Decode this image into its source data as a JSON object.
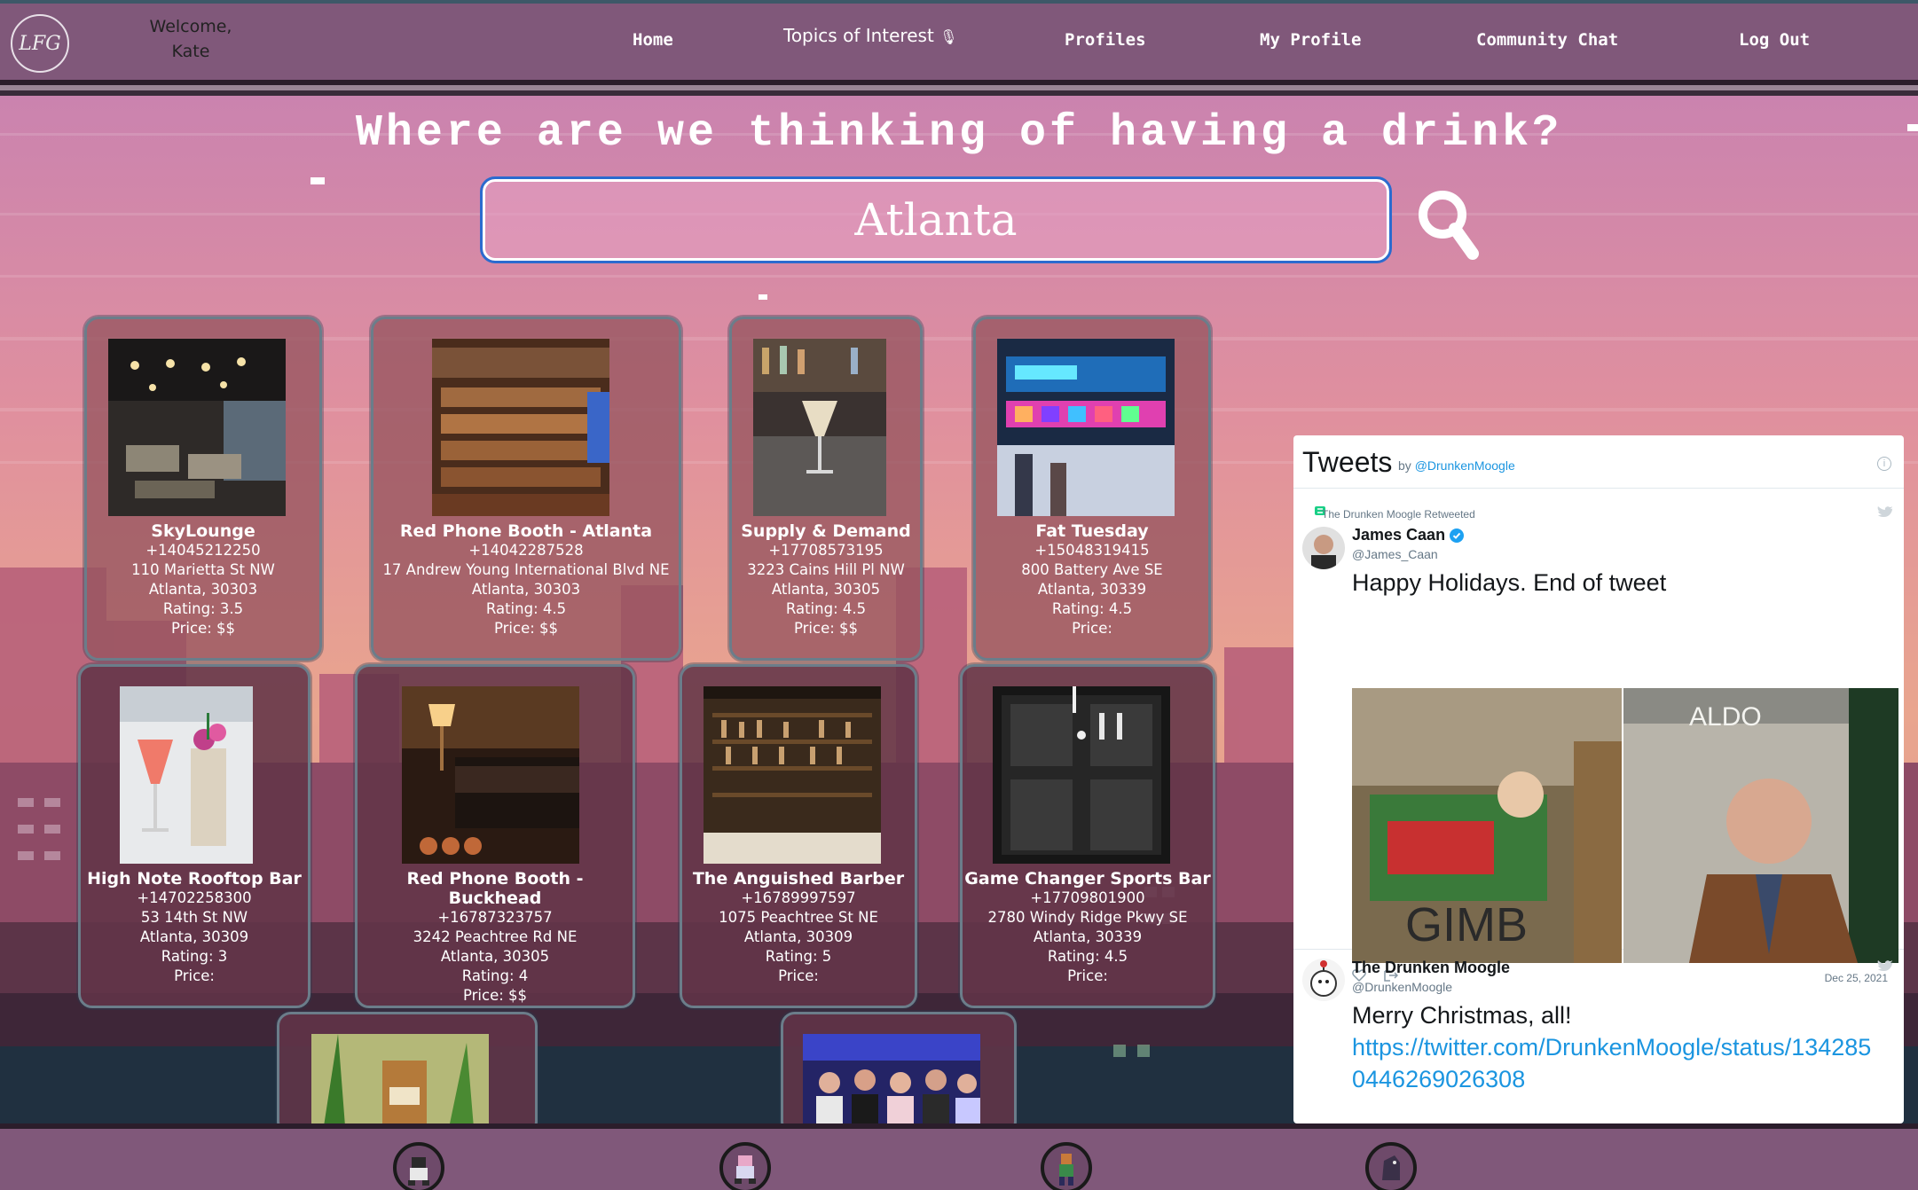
{
  "nav": {
    "logo_text": "LFG",
    "welcome_line1": "Welcome,",
    "welcome_line2": "Kate",
    "home": "Home",
    "topics": "Topics of Interest",
    "topics_icon": "🎙",
    "profiles": "Profiles",
    "my_profile": "My Profile",
    "community_chat": "Community Chat",
    "logout": "Log Out"
  },
  "headline": "Where are we thinking of having a drink?",
  "search": {
    "value": "Atlanta"
  },
  "venues": [
    {
      "name": "SkyLounge",
      "phone": "+14045212250",
      "street": "110 Marietta St NW",
      "city": "Atlanta, 30303",
      "rating": "Rating: 3.5",
      "price": "Price: $$"
    },
    {
      "name": "Red Phone Booth - Atlanta",
      "phone": "+14042287528",
      "street": "17 Andrew Young International Blvd NE",
      "city": "Atlanta, 30303",
      "rating": "Rating: 4.5",
      "price": "Price: $$"
    },
    {
      "name": "Supply & Demand",
      "phone": "+17708573195",
      "street": "3223 Cains Hill Pl NW",
      "city": "Atlanta, 30305",
      "rating": "Rating: 4.5",
      "price": "Price: $$"
    },
    {
      "name": "Fat Tuesday",
      "phone": "+15048319415",
      "street": "800 Battery Ave SE",
      "city": "Atlanta, 30339",
      "rating": "Rating: 4.5",
      "price": "Price:"
    },
    {
      "name": "High Note Rooftop Bar",
      "phone": "+14702258300",
      "street": "53 14th St NW",
      "city": "Atlanta, 30309",
      "rating": "Rating: 3",
      "price": "Price:"
    },
    {
      "name": "Red Phone Booth - Buckhead",
      "phone": "+16787323757",
      "street": "3242 Peachtree Rd NE",
      "city": "Atlanta, 30305",
      "rating": "Rating: 4",
      "price": "Price: $$"
    },
    {
      "name": "The Anguished Barber",
      "phone": "+16789997597",
      "street": "1075 Peachtree St NE",
      "city": "Atlanta, 30309",
      "rating": "Rating: 5",
      "price": "Price:"
    },
    {
      "name": "Game Changer Sports Bar",
      "phone": "+17709801900",
      "street": "2780 Windy Ridge Pkwy SE",
      "city": "Atlanta, 30339",
      "rating": "Rating: 4.5",
      "price": "Price:"
    }
  ],
  "tweets": {
    "title": "Tweets",
    "by": "by",
    "account": "@DrunkenMoogle",
    "info": "i",
    "items": [
      {
        "retweet_note": "The Drunken Moogle Retweeted",
        "name": "James Caan",
        "handle": "@James_Caan",
        "text": "Happy Holidays. End of tweet",
        "media_sign": "ALDO",
        "media_window": "GIMB",
        "date": "Dec 25, 2021"
      },
      {
        "name": "The Drunken Moogle",
        "handle": "@DrunkenMoogle",
        "text": "Merry Christmas, all!",
        "link": "https://twitter.com/DrunkenMoogle/status/1342850446269026308"
      }
    ]
  },
  "colors": {
    "nav_bg": "#80587a",
    "card_border": "#6b7d8a",
    "search_outline": "#2b6bcf",
    "twitter_blue": "#1b95e0"
  }
}
